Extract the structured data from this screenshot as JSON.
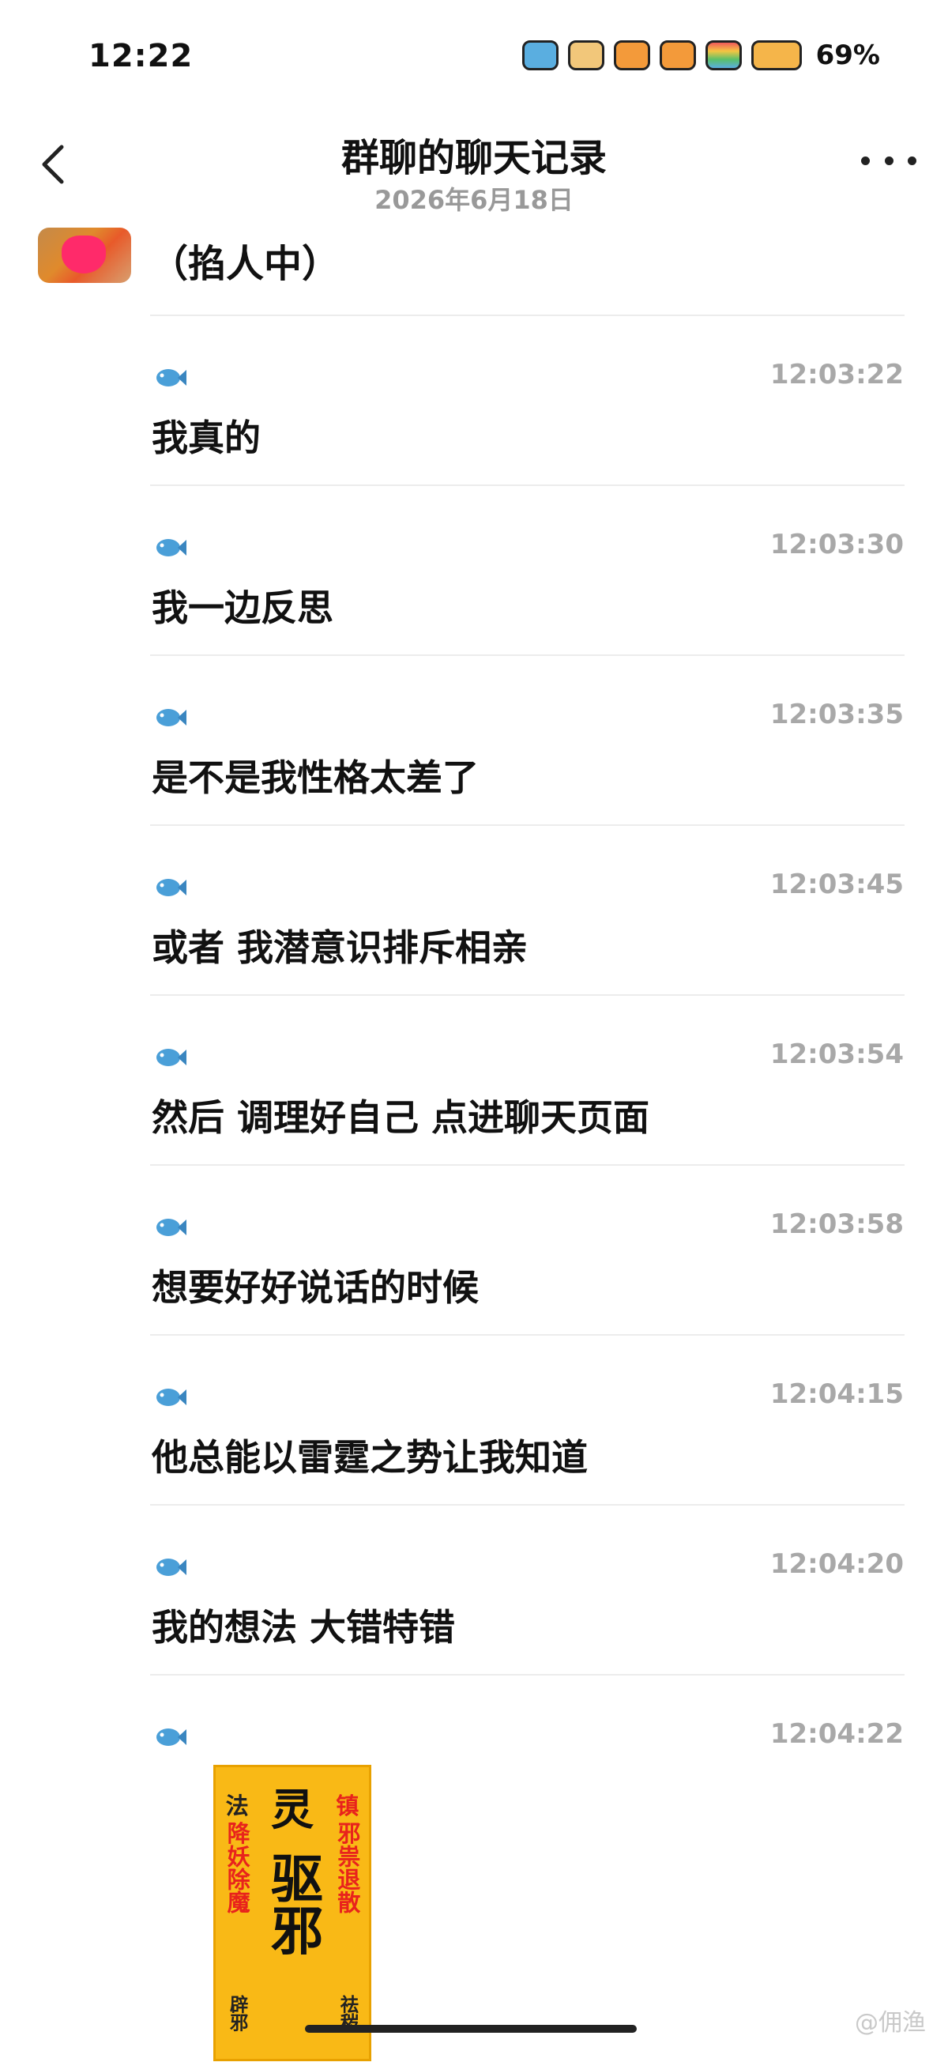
{
  "status_bar": {
    "time": "12:22",
    "battery": "69%",
    "icons": [
      "hippo-icon",
      "dog-icon",
      "carrot-icon",
      "carrot-icon",
      "rainbow-icon",
      "cat-battery-icon"
    ]
  },
  "header": {
    "title": "群聊的聊天记录",
    "date": "2026年6月18日",
    "back_icon": "chevron-left-icon",
    "more_icon": "more-dots-icon"
  },
  "top_message": {
    "text": "（掐人中）"
  },
  "messages": [
    {
      "time": "12:03:22",
      "text": "我真的"
    },
    {
      "time": "12:03:30",
      "text": "我一边反思"
    },
    {
      "time": "12:03:35",
      "text": "是不是我性格太差了"
    },
    {
      "time": "12:03:45",
      "text": "或者 我潜意识排斥相亲"
    },
    {
      "time": "12:03:54",
      "text": "然后 调理好自己 点进聊天页面"
    },
    {
      "time": "12:03:58",
      "text": "想要好好说话的时候"
    },
    {
      "time": "12:04:15",
      "text": "他总能以雷霆之势让我知道"
    },
    {
      "time": "12:04:20",
      "text": "我的想法 大错特错"
    }
  ],
  "sticker_message": {
    "time": "12:04:22",
    "sticker": {
      "left_top": "法",
      "right_top": "镇",
      "center": "驱邪",
      "left_side": "降妖除魔",
      "right_side": "邪祟退散",
      "left_bottom": "辟邪",
      "right_bottom": "祛秽"
    }
  },
  "watermark": "@佣渔",
  "colors": {
    "timestamp": "#a8a8a8",
    "divider": "#ececec",
    "sticker_bg": "#f9b916",
    "sticker_red": "#e8231c"
  }
}
